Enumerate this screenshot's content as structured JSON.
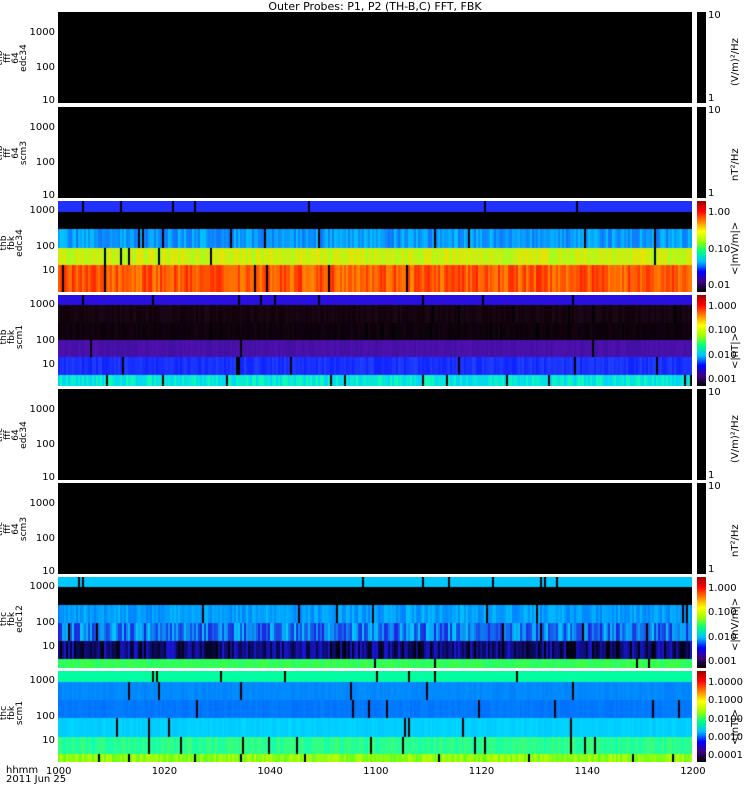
{
  "title": "Outer Probes: P1, P2 (TH-B,C) FFT, FBK",
  "chart_data": {
    "type": "heatmap",
    "title": "Outer Probes: P1, P2 (TH-B,C) FFT, FBK",
    "xlabel": "hhmm",
    "date": "2011 Jun 25",
    "x_ticks": [
      "1000",
      "1020",
      "1040",
      "1100",
      "1120",
      "1140",
      "1200"
    ],
    "panels": [
      {
        "label": [
          "thb",
          "fff",
          "64",
          "edc34"
        ],
        "yticks": [
          "1000",
          "100",
          "10"
        ],
        "unit": "(V/m)²/Hz",
        "cticks": [
          "10",
          "1"
        ],
        "bands": [
          [
            "#000000",
            "#000000",
            1
          ]
        ]
      },
      {
        "label": [
          "thb",
          "fff",
          "64",
          "scm3"
        ],
        "yticks": [
          "1000",
          "100",
          "10"
        ],
        "unit": "nT²/Hz",
        "cticks": [
          "10",
          "1"
        ],
        "bands": [
          [
            "#000000",
            "#000000",
            1
          ]
        ]
      },
      {
        "label": [
          "thb",
          "fbk",
          "edc34"
        ],
        "yticks": [
          "1000",
          "100",
          "10"
        ],
        "unit": "<|mV/m|>",
        "cticks": [
          "1.00",
          "0.10",
          "0.01"
        ],
        "bands": [
          [
            "#2030ff",
            "#2030ff",
            11
          ],
          [
            "#000000",
            "#000000",
            17
          ],
          [
            "#00c8ff",
            "#1070ff",
            19
          ],
          [
            "#a0ff20",
            "#f0e000",
            17
          ],
          [
            "#ff8c00",
            "#ff2000",
            28
          ]
        ]
      },
      {
        "label": [
          "thb",
          "fbk",
          "scm1"
        ],
        "yticks": [
          "1000",
          "100",
          "10"
        ],
        "unit": "<|nT|>",
        "cticks": [
          "1.000",
          "0.100",
          "0.010",
          "0.001"
        ],
        "bands": [
          [
            "#2a10e0",
            "#2a10e0",
            10
          ],
          [
            "#1a0818",
            "#100008",
            18
          ],
          [
            "#0a0008",
            "#14040f",
            17
          ],
          [
            "#5010b0",
            "#4010a0",
            17
          ],
          [
            "#1020ff",
            "#2040ff",
            18
          ],
          [
            "#00d0ff",
            "#10ffb0",
            11
          ]
        ]
      },
      {
        "label": [
          "thc",
          "fff",
          "64",
          "edc34"
        ],
        "yticks": [
          "1000",
          "100",
          "10"
        ],
        "unit": "(V/m)²/Hz",
        "cticks": [
          "10",
          "1"
        ],
        "bands": [
          [
            "#000000",
            "#000000",
            1
          ]
        ]
      },
      {
        "label": [
          "thc",
          "fff",
          "64",
          "scm3"
        ],
        "yticks": [
          "1000",
          "100",
          "10"
        ],
        "unit": "nT²/Hz",
        "cticks": [
          "10",
          "1"
        ],
        "bands": [
          [
            "#000000",
            "#000000",
            1
          ]
        ]
      },
      {
        "label": [
          "thc",
          "fbk",
          "edc12"
        ],
        "yticks": [
          "1000",
          "100",
          "10"
        ],
        "unit": "<|mV/m|>",
        "cticks": [
          "1.000",
          "0.100",
          "0.010",
          "0.001"
        ],
        "bands": [
          [
            "#00c8ff",
            "#00c8ff",
            10
          ],
          [
            "#000000",
            "#000000",
            18
          ],
          [
            "#0080ff",
            "#00c0ff",
            18
          ],
          [
            "#00d0ff",
            "#2020e0",
            18
          ],
          [
            "#1818e0",
            "#000000",
            18
          ],
          [
            "#20ff70",
            "#40ff40",
            9
          ]
        ]
      },
      {
        "label": [
          "thc",
          "fbk",
          "scm1"
        ],
        "yticks": [
          "1000",
          "100",
          "10"
        ],
        "unit": "<|nT|>",
        "cticks": [
          "1.0000",
          "0.1000",
          "0.0100",
          "0.0010",
          "0.0001"
        ],
        "bands": [
          [
            "#00ffa0",
            "#00ffa0",
            11
          ],
          [
            "#0080ff",
            "#0090ff",
            18
          ],
          [
            "#0070ff",
            "#0080ff",
            18
          ],
          [
            "#00d8ff",
            "#00c8ff",
            19
          ],
          [
            "#10ffb0",
            "#40ff70",
            17
          ],
          [
            "#60ff20",
            "#c0ff00",
            8
          ]
        ]
      }
    ]
  }
}
